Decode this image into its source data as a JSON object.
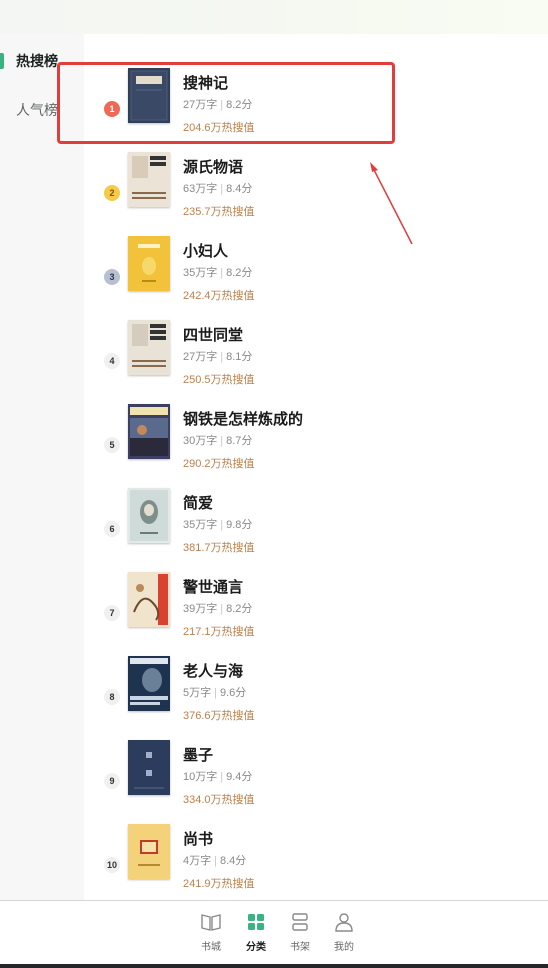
{
  "sidebar": {
    "tabs": [
      {
        "label": "热搜榜",
        "active": true
      },
      {
        "label": "人气榜",
        "active": false
      }
    ]
  },
  "books": [
    {
      "rank": "1",
      "title": "搜神记",
      "words": "27万字",
      "score": "8.2分",
      "heat": "204.6万热搜值",
      "cover_color": "#2f3b52"
    },
    {
      "rank": "2",
      "title": "源氏物语",
      "words": "63万字",
      "score": "8.4分",
      "heat": "235.7万热搜值",
      "cover_color": "#e9e0d2"
    },
    {
      "rank": "3",
      "title": "小妇人",
      "words": "35万字",
      "score": "8.2分",
      "heat": "242.4万热搜值",
      "cover_color": "#f2c43c"
    },
    {
      "rank": "4",
      "title": "四世同堂",
      "words": "27万字",
      "score": "8.1分",
      "heat": "250.5万热搜值",
      "cover_color": "#e7e1d6"
    },
    {
      "rank": "5",
      "title": "钢铁是怎样炼成的",
      "words": "30万字",
      "score": "8.7分",
      "heat": "290.2万热搜值",
      "cover_color": "#3a3a5a"
    },
    {
      "rank": "6",
      "title": "简爱",
      "words": "35万字",
      "score": "9.8分",
      "heat": "381.7万热搜值",
      "cover_color": "#dfe6e4"
    },
    {
      "rank": "7",
      "title": "警世通言",
      "words": "39万字",
      "score": "8.2分",
      "heat": "217.1万热搜值",
      "cover_color": "#efe2c8"
    },
    {
      "rank": "8",
      "title": "老人与海",
      "words": "5万字",
      "score": "9.6分",
      "heat": "376.6万热搜值",
      "cover_color": "#1f3552"
    },
    {
      "rank": "9",
      "title": "墨子",
      "words": "10万字",
      "score": "9.4分",
      "heat": "334.0万热搜值",
      "cover_color": "#2b3b5c"
    },
    {
      "rank": "10",
      "title": "尚书",
      "words": "4万字",
      "score": "8.4分",
      "heat": "241.9万热搜值",
      "cover_color": "#f3d27c"
    }
  ],
  "nav": {
    "items": [
      {
        "label": "书城",
        "icon": "book-icon",
        "active": false
      },
      {
        "label": "分类",
        "icon": "grid-icon",
        "active": true
      },
      {
        "label": "书架",
        "icon": "shelf-icon",
        "active": false
      },
      {
        "label": "我的",
        "icon": "person-icon",
        "active": false
      }
    ]
  },
  "colors": {
    "accent": "#3ab281",
    "heat_text": "#b9814e",
    "highlight": "#e23d3d"
  }
}
